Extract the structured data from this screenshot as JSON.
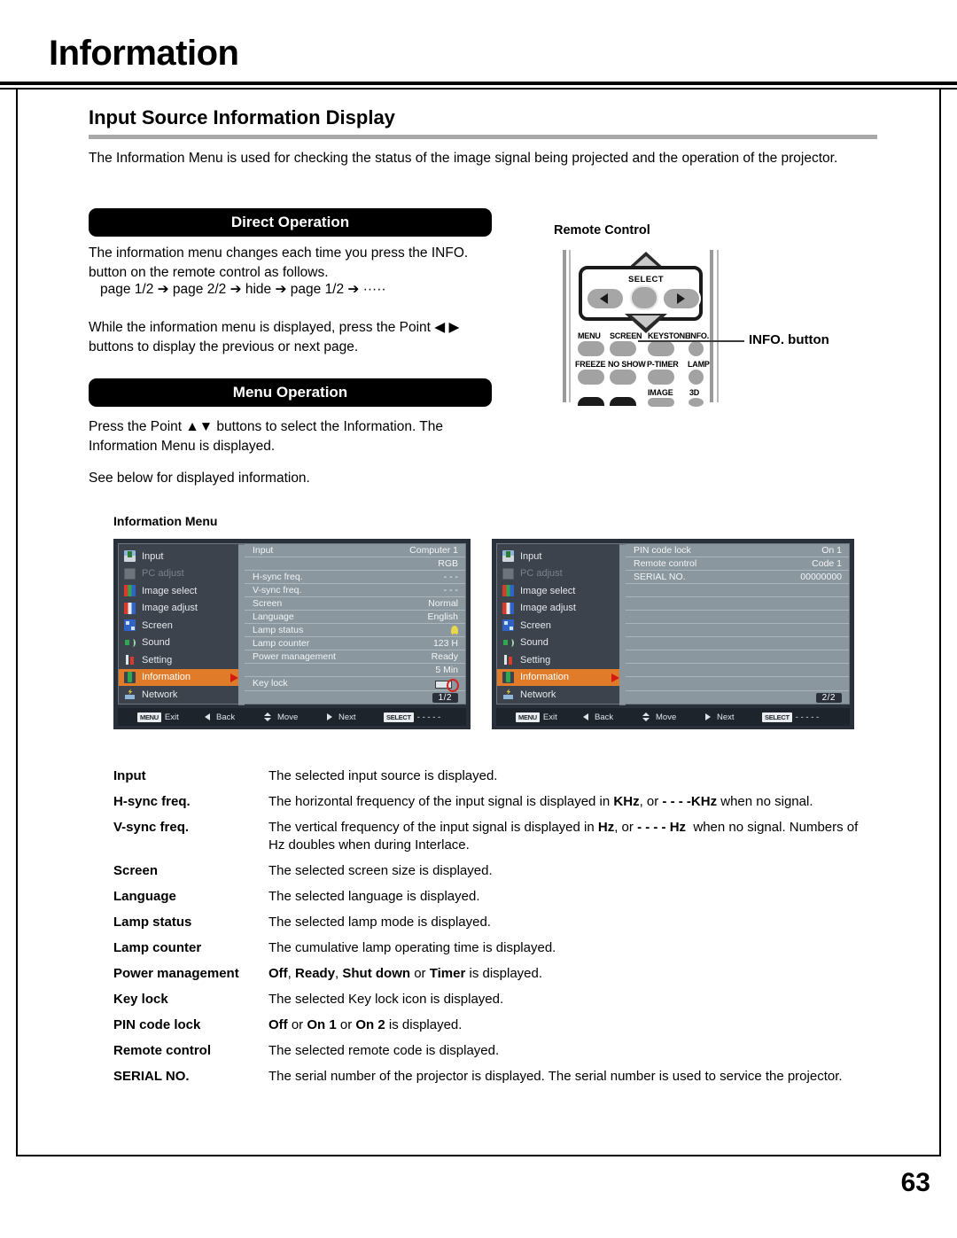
{
  "header": {
    "chapter": "Information"
  },
  "section": {
    "title": "Input Source Information Display",
    "intro": "The Information Menu is used for checking the status of the image signal being projected and the operation of the projector."
  },
  "direct_operation": {
    "banner": "Direct Operation",
    "paragraph1": "The information menu changes each time you press the INFO. button on the remote control as follows.",
    "sequence": "page 1/2 ➔ page 2/2 ➔ hide ➔ page 1/2 ➔ ·····",
    "paragraph2": "While the information menu is displayed, press the Point ◀ ▶ buttons to display the previous or next page."
  },
  "menu_operation": {
    "banner": "Menu Operation",
    "paragraph1": "Press the Point ▲▼ buttons to select the Information. The Information Menu is displayed.",
    "paragraph2": "See below for displayed information.",
    "figure_label": "Information Menu"
  },
  "remote": {
    "title": "Remote Control",
    "select_label": "SELECT",
    "callout": "INFO. button",
    "row1": [
      "MENU",
      "SCREEN",
      "KEYSTONE",
      "INFO."
    ],
    "row2": [
      "FREEZE",
      "NO SHOW",
      "P-TIMER",
      "LAMP"
    ],
    "row3": [
      "IMAGE",
      "3D"
    ]
  },
  "osd": {
    "sidebar": [
      {
        "label": "Input",
        "icon": "input-icon",
        "state": "normal"
      },
      {
        "label": "PC adjust",
        "icon": "pc-adjust-icon",
        "state": "dim"
      },
      {
        "label": "Image select",
        "icon": "image-select-icon",
        "state": "normal"
      },
      {
        "label": "Image adjust",
        "icon": "image-adjust-icon",
        "state": "normal"
      },
      {
        "label": "Screen",
        "icon": "screen-icon",
        "state": "normal"
      },
      {
        "label": "Sound",
        "icon": "sound-icon",
        "state": "normal"
      },
      {
        "label": "Setting",
        "icon": "setting-icon",
        "state": "normal"
      },
      {
        "label": "Information",
        "icon": "information-icon",
        "state": "selected"
      },
      {
        "label": "Network",
        "icon": "network-icon",
        "state": "normal"
      }
    ],
    "footer": {
      "exit_key": "MENU",
      "exit": "Exit",
      "back": "Back",
      "move": "Move",
      "next": "Next",
      "select_key": "SELECT",
      "select_dashes": "- - - - -"
    },
    "page1": {
      "page_badge": "1/2",
      "rows": [
        {
          "label": "Input",
          "value": "Computer 1"
        },
        {
          "label": "",
          "value": "RGB"
        },
        {
          "label": "H-sync freq.",
          "value": "- - -"
        },
        {
          "label": "V-sync freq.",
          "value": "- - -"
        },
        {
          "label": "Screen",
          "value": "Normal"
        },
        {
          "label": "Language",
          "value": "English"
        },
        {
          "label": "Lamp status",
          "value": "",
          "icon": "lamp-icon"
        },
        {
          "label": "Lamp counter",
          "value": "123 H"
        },
        {
          "label": "Power management",
          "value": "Ready"
        },
        {
          "label": "",
          "value": "5 Min"
        },
        {
          "label": "Key lock",
          "value": "",
          "icon": "key-lock-icon"
        }
      ]
    },
    "page2": {
      "page_badge": "2/2",
      "rows": [
        {
          "label": "PIN code lock",
          "value": "On 1"
        },
        {
          "label": "Remote control",
          "value": "Code 1"
        },
        {
          "label": "SERIAL NO.",
          "value": "00000000"
        }
      ]
    }
  },
  "definitions": [
    {
      "term": "Input",
      "desc": "The selected input source is displayed."
    },
    {
      "term": "H-sync freq.",
      "desc_html": "The horizontal frequency of the input signal is displayed in <b>KHz</b>, or <b>- - - -KHz</b> when no signal."
    },
    {
      "term": "V-sync freq.",
      "desc_html": "The vertical frequency of the input signal is displayed in <b>Hz</b>, or <b>- - - - Hz</b>&nbsp; when no signal. Numbers of Hz doubles when during Interlace."
    },
    {
      "term": "Screen",
      "desc": "The selected screen size is displayed."
    },
    {
      "term": "Language",
      "desc": "The selected language is displayed."
    },
    {
      "term": "Lamp status",
      "desc": "The selected lamp mode is displayed."
    },
    {
      "term": "Lamp counter",
      "desc": "The cumulative lamp operating time is displayed."
    },
    {
      "term": "Power management",
      "desc_html": "<b>Off</b>, <b>Ready</b>, <b>Shut down</b> or <b>Timer</b> is displayed."
    },
    {
      "term": "Key lock",
      "desc": "The selected Key lock icon is displayed."
    },
    {
      "term": "PIN code lock",
      "desc_html": "<b>Off</b> or <b>On 1</b> or <b>On 2</b> is displayed."
    },
    {
      "term": "Remote control",
      "desc": "The selected remote code is displayed."
    },
    {
      "term": "SERIAL NO.",
      "desc": "The serial number of the projector is displayed. The serial number is used to service the projector."
    }
  ],
  "footer": {
    "page_number": "63"
  }
}
